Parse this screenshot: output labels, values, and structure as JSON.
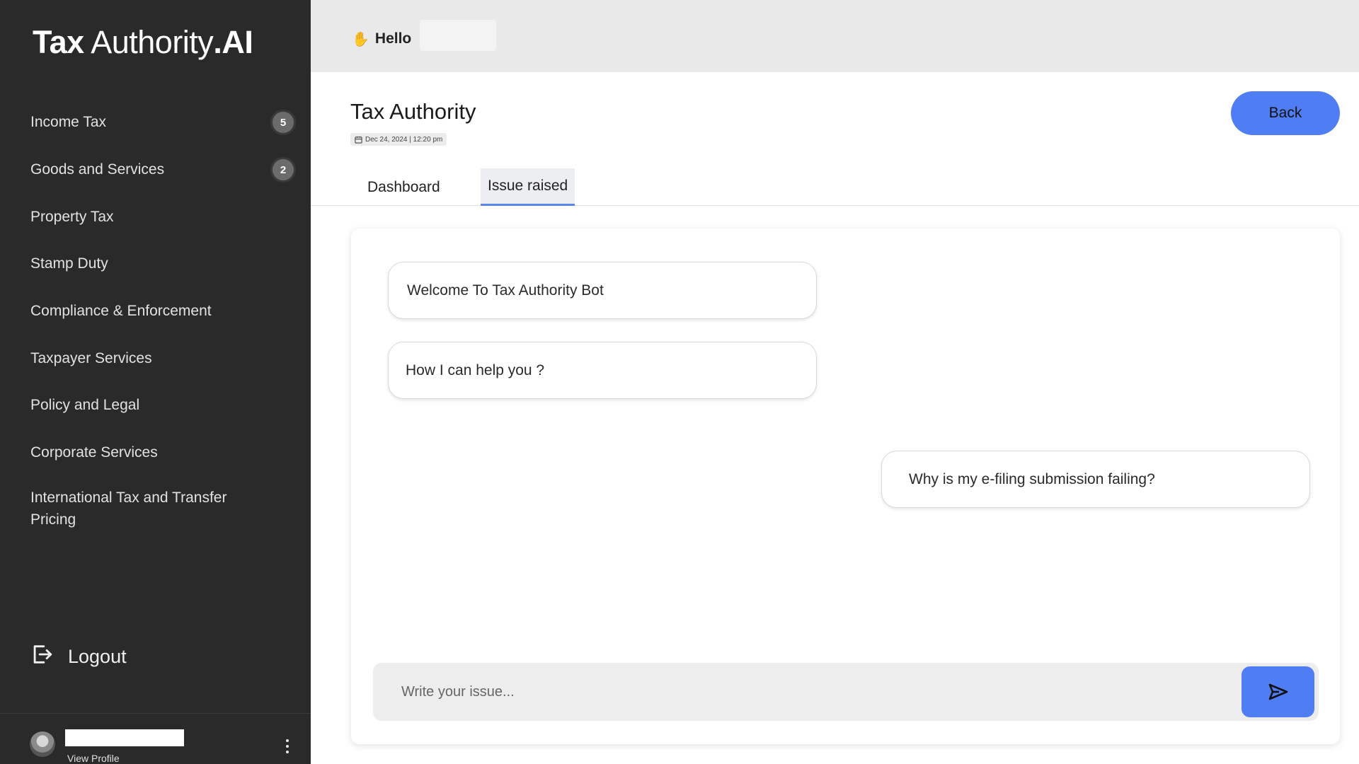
{
  "brand": {
    "part1": "Tax",
    "part2": " Authority",
    "part3": ".AI"
  },
  "sidebar": {
    "items": [
      {
        "label": "Income Tax",
        "badge": "5"
      },
      {
        "label": "Goods and Services",
        "badge": "2"
      },
      {
        "label": "Property Tax"
      },
      {
        "label": "Stamp Duty"
      },
      {
        "label": "Compliance & Enforcement"
      },
      {
        "label": "Taxpayer Services"
      },
      {
        "label": "Policy and Legal"
      },
      {
        "label": "Corporate Services"
      },
      {
        "label": "International Tax and Transfer Pricing"
      }
    ],
    "logout_label": "Logout",
    "profile": {
      "view_profile_label": "View Profile"
    }
  },
  "header": {
    "greeting": "Hello"
  },
  "main": {
    "title": "Tax Authority",
    "date": "Dec 24, 2024 | 12:20 pm",
    "back_label": "Back",
    "tabs": [
      {
        "label": "Dashboard",
        "active": false
      },
      {
        "label": "Issue raised",
        "active": true
      }
    ],
    "chat": {
      "messages": [
        {
          "from": "bot",
          "text": "Welcome To Tax Authority Bot"
        },
        {
          "from": "bot",
          "text": "How I can help you ?"
        },
        {
          "from": "user",
          "text": "Why is my e-filing submission failing?"
        }
      ],
      "input_placeholder": "Write your issue...",
      "send_icon": "send-icon"
    }
  },
  "colors": {
    "sidebar_bg": "#2a2a2a",
    "accent": "#4f7df3",
    "topbar_bg": "#e9e9ea"
  }
}
